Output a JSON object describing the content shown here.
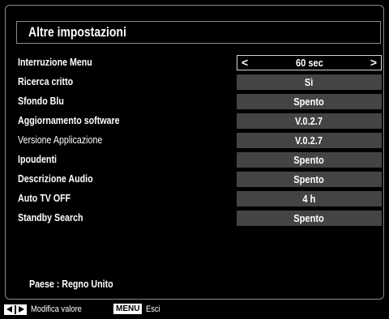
{
  "title": "Altre impostazioni",
  "settings": [
    {
      "label": "Interruzione Menu",
      "value": "60 sec"
    },
    {
      "label": "Ricerca critto",
      "value": "Sì"
    },
    {
      "label": "Sfondo Blu",
      "value": "Spento"
    },
    {
      "label": "Aggiornamento software",
      "value": "V.0.2.7"
    },
    {
      "label": "Versione Applicazione",
      "value": "V.0.2.7"
    },
    {
      "label": "Ipoudenti",
      "value": "Spento"
    },
    {
      "label": "Descrizione Audio",
      "value": "Spento"
    },
    {
      "label": "Auto TV OFF",
      "value": "4 h"
    },
    {
      "label": "Standby Search",
      "value": "Spento"
    }
  ],
  "selected_arrows": {
    "left": "<",
    "right": ">"
  },
  "country": "Paese : Regno Unito",
  "footer": {
    "left_right_icon": "left-right-arrows-icon",
    "modify_label": "Modifica valore",
    "menu_key": "MENU",
    "exit_label": "Esci"
  }
}
